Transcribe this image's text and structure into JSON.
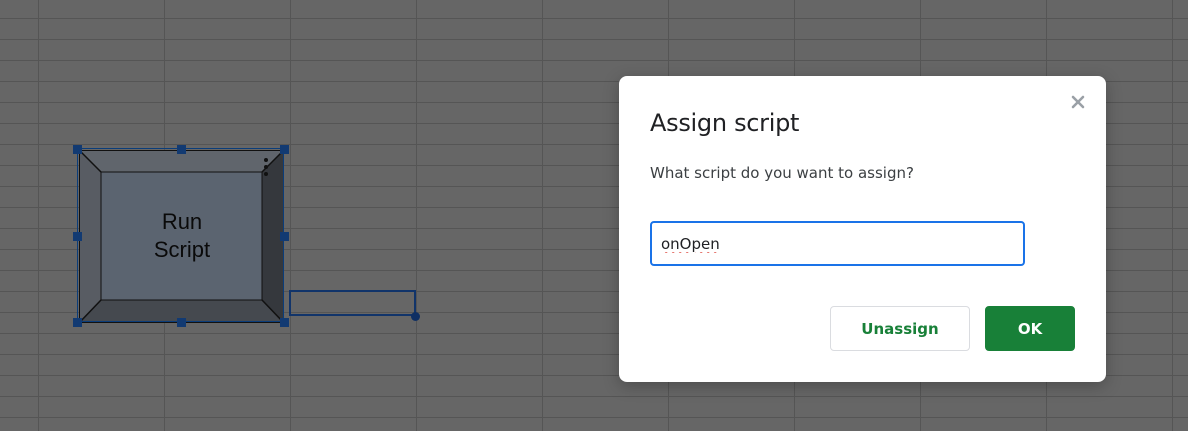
{
  "drawing": {
    "label": "Run\nScript",
    "face_color": "#5b6470",
    "bevel_color": "#3a3e44"
  },
  "dialog": {
    "title": "Assign script",
    "prompt": "What script do you want to assign?",
    "input_value": "onOpen",
    "close_icon": "close-icon",
    "unassign_label": "Unassign",
    "ok_label": "OK"
  },
  "colors": {
    "accent": "#1a73e8",
    "primary_button": "#188038"
  }
}
